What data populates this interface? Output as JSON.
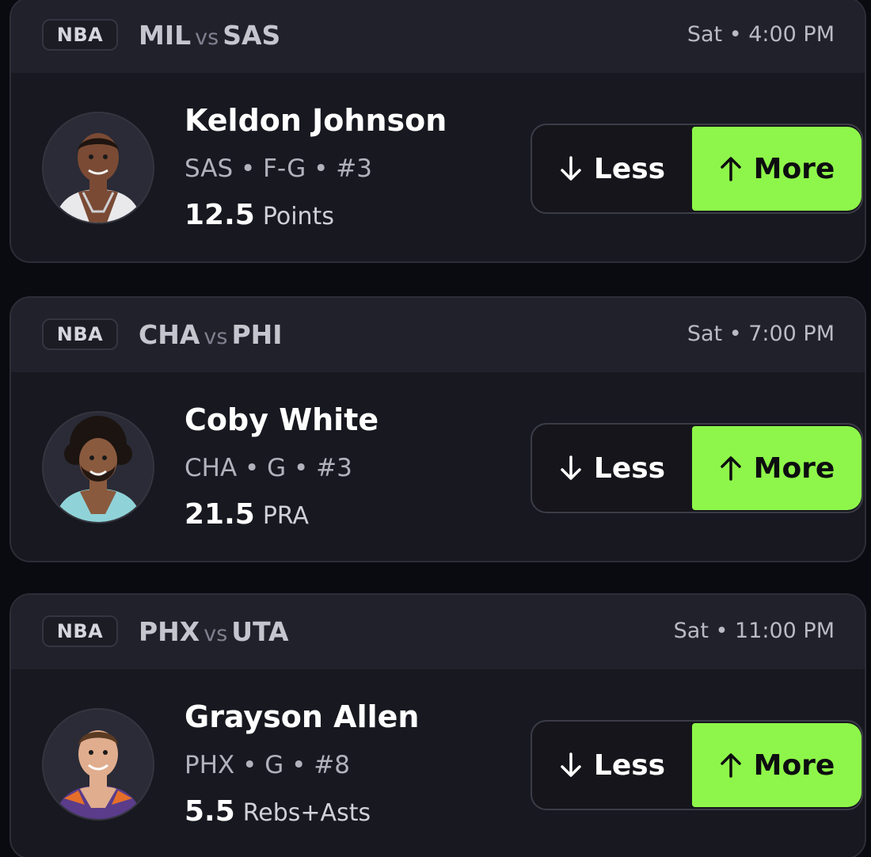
{
  "cards": [
    {
      "league": "NBA",
      "home": "MIL",
      "vs": "vs",
      "away": "SAS",
      "time": "Sat • 4:00 PM",
      "player_name": "Keldon Johnson",
      "meta": "SAS • F-G • #3",
      "line_value": "12.5",
      "line_stat": "Points",
      "less_label": "Less",
      "more_label": "More",
      "selected": "more",
      "jersey_color": "#e9e9ec",
      "skin_color": "#7a4a34"
    },
    {
      "league": "NBA",
      "home": "CHA",
      "vs": "vs",
      "away": "PHI",
      "time": "Sat • 7:00 PM",
      "player_name": "Coby White",
      "meta": "CHA • G • #3",
      "line_value": "21.5",
      "line_stat": "PRA",
      "less_label": "Less",
      "more_label": "More",
      "selected": "more",
      "jersey_color": "#8fd3d8",
      "skin_color": "#8a5a3e"
    },
    {
      "league": "NBA",
      "home": "PHX",
      "vs": "vs",
      "away": "UTA",
      "time": "Sat • 11:00 PM",
      "player_name": "Grayson Allen",
      "meta": "PHX • G • #8",
      "line_value": "5.5",
      "line_stat": "Rebs+Asts",
      "less_label": "Less",
      "more_label": "More",
      "selected": "more",
      "jersey_color": "#5a3c8a",
      "skin_color": "#e0ad8e"
    }
  ],
  "colors": {
    "accent": "#8ef64a",
    "card_bg": "#181820",
    "header_bg": "#20212a",
    "page_bg": "#0a0b10"
  }
}
